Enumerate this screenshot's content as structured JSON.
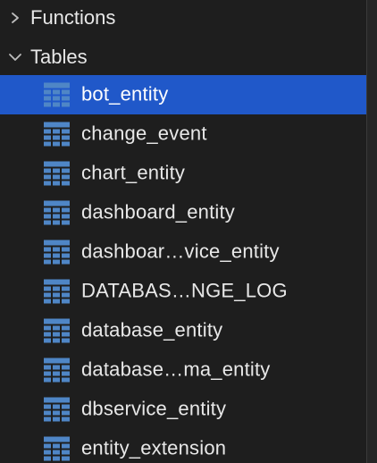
{
  "tree": {
    "groups": [
      {
        "label": "Functions",
        "expanded": false,
        "icon": "chevron-right-icon"
      },
      {
        "label": "Tables",
        "expanded": true,
        "icon": "chevron-down-icon"
      }
    ],
    "tables": [
      {
        "label": "bot_entity",
        "selected": true
      },
      {
        "label": "change_event",
        "selected": false
      },
      {
        "label": "chart_entity",
        "selected": false
      },
      {
        "label": "dashboard_entity",
        "selected": false
      },
      {
        "label": "dashboar…vice_entity",
        "selected": false
      },
      {
        "label": "DATABAS…NGE_LOG",
        "selected": false
      },
      {
        "label": "database_entity",
        "selected": false
      },
      {
        "label": "database…ma_entity",
        "selected": false
      },
      {
        "label": "dbservice_entity",
        "selected": false
      },
      {
        "label": "entity_extension",
        "selected": false
      }
    ],
    "table_icon": "table-grid-icon"
  },
  "colors": {
    "background": "#1e1e1e",
    "selection": "#2058c9",
    "icon_blue": "#4f86c6",
    "text": "#e8e8e8"
  }
}
